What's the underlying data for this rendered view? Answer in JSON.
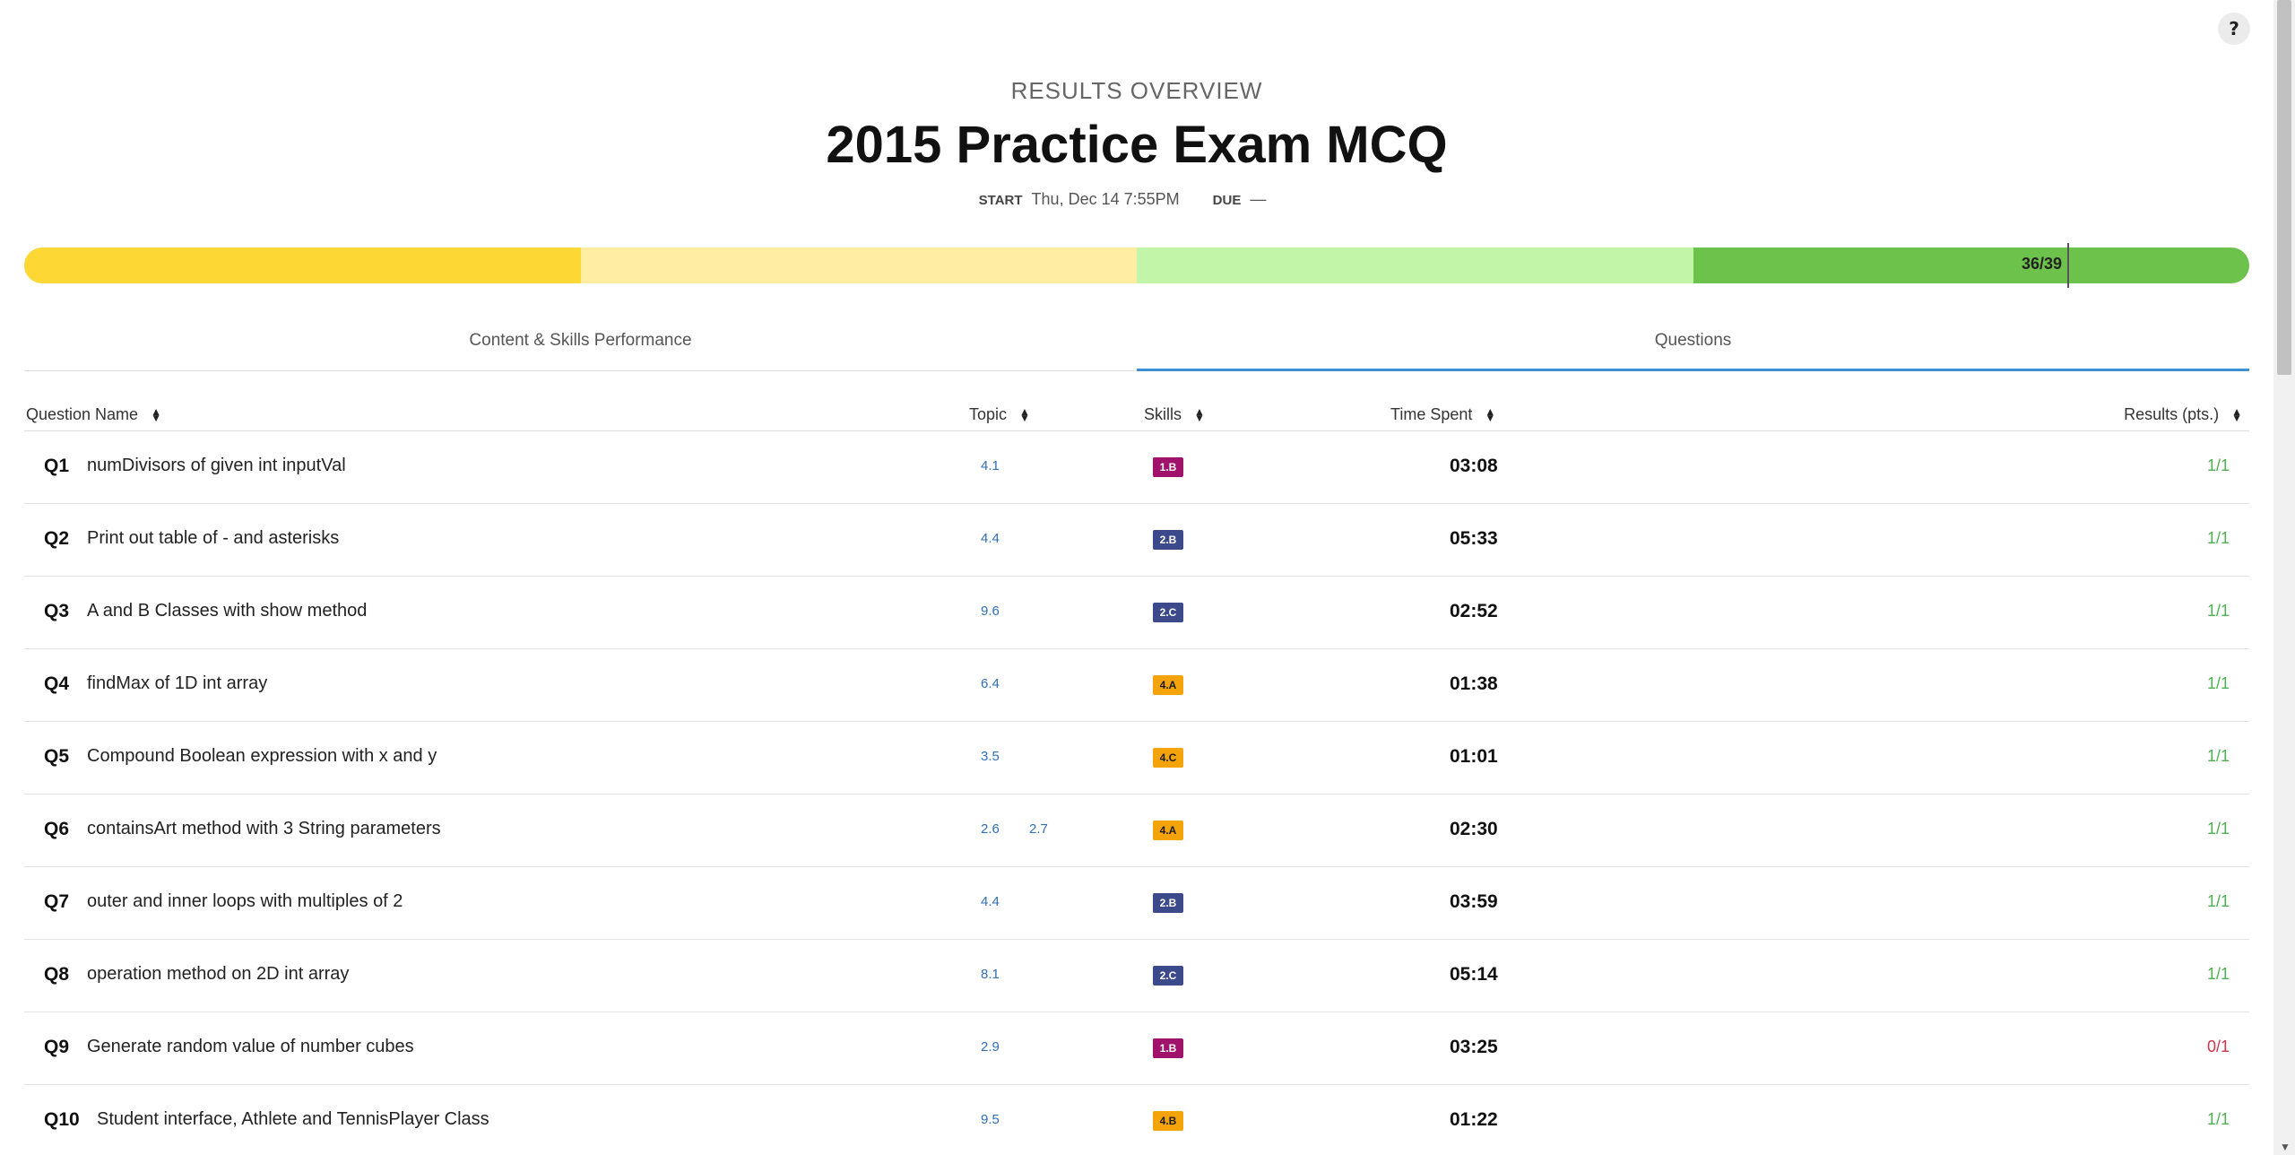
{
  "help": {
    "label": "?"
  },
  "header": {
    "eyebrow": "RESULTS OVERVIEW",
    "title": "2015 Practice Exam MCQ",
    "start_label": "START",
    "start_value": "Thu, Dec 14 7:55PM",
    "due_label": "DUE",
    "due_value": "—"
  },
  "score": {
    "label": "36/39",
    "earned": 36,
    "total": 39
  },
  "colors": {
    "band_1": "#fdd835",
    "band_2": "#ffeea1",
    "band_3": "#c3f5a9",
    "band_4": "#6cc24a",
    "tab_active": "#3d8fd6",
    "topic_link": "#2f6fb5",
    "skill_1": "#a0126b",
    "skill_2": "#3c4a8c",
    "skill_4": "#f5a30a",
    "result_correct": "#4caf50",
    "result_incorrect": "#d0334a"
  },
  "tabs": [
    {
      "label": "Content & Skills Performance",
      "active": false
    },
    {
      "label": "Questions",
      "active": true
    }
  ],
  "table": {
    "columns": [
      "Question Name",
      "Topic",
      "Skills",
      "Time Spent",
      "Results (pts.)"
    ],
    "rows": [
      {
        "num": "Q1",
        "name": "numDivisors of given int inputVal",
        "topics": [
          "4.1"
        ],
        "skill": "1.B",
        "time": "03:08",
        "result": "1/1"
      },
      {
        "num": "Q2",
        "name": "Print out table of - and asterisks",
        "topics": [
          "4.4"
        ],
        "skill": "2.B",
        "time": "05:33",
        "result": "1/1"
      },
      {
        "num": "Q3",
        "name": "A and B Classes with show method",
        "topics": [
          "9.6"
        ],
        "skill": "2.C",
        "time": "02:52",
        "result": "1/1"
      },
      {
        "num": "Q4",
        "name": "findMax of 1D int array",
        "topics": [
          "6.4"
        ],
        "skill": "4.A",
        "time": "01:38",
        "result": "1/1"
      },
      {
        "num": "Q5",
        "name": "Compound Boolean expression with x and y",
        "topics": [
          "3.5"
        ],
        "skill": "4.C",
        "time": "01:01",
        "result": "1/1"
      },
      {
        "num": "Q6",
        "name": "containsArt method with 3 String parameters",
        "topics": [
          "2.6",
          "2.7"
        ],
        "skill": "4.A",
        "time": "02:30",
        "result": "1/1"
      },
      {
        "num": "Q7",
        "name": "outer and inner loops with multiples of 2",
        "topics": [
          "4.4"
        ],
        "skill": "2.B",
        "time": "03:59",
        "result": "1/1"
      },
      {
        "num": "Q8",
        "name": "operation method on 2D int array",
        "topics": [
          "8.1"
        ],
        "skill": "2.C",
        "time": "05:14",
        "result": "1/1"
      },
      {
        "num": "Q9",
        "name": "Generate random value of number cubes",
        "topics": [
          "2.9"
        ],
        "skill": "1.B",
        "time": "03:25",
        "result": "0/1"
      },
      {
        "num": "Q10",
        "name": "Student interface, Athlete and TennisPlayer Class",
        "topics": [
          "9.5"
        ],
        "skill": "4.B",
        "time": "01:22",
        "result": "1/1"
      }
    ]
  }
}
